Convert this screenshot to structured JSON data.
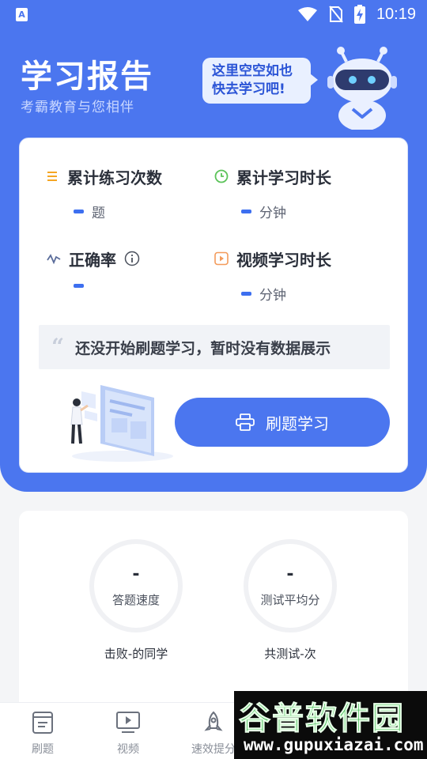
{
  "status_bar": {
    "app_badge": "A",
    "time": "10:19"
  },
  "header": {
    "title": "学习报告",
    "subtitle": "考霸教育与您相伴",
    "bubble_line1": "这里空空如也",
    "bubble_line2": "快去学习吧!"
  },
  "stats": [
    {
      "label": "累计练习次数",
      "value": "",
      "unit": "题",
      "icon": "list-icon",
      "icon_color": "#f5a623"
    },
    {
      "label": "累计学习时长",
      "value": "",
      "unit": "分钟",
      "icon": "clock-icon",
      "icon_color": "#5cc35a"
    },
    {
      "label": "正确率",
      "value": "",
      "unit": "",
      "icon": "pulse-icon",
      "icon_color": "#5a6c9a"
    },
    {
      "label": "视频学习时长",
      "value": "",
      "unit": "分钟",
      "icon": "video-icon",
      "icon_color": "#f39b5b"
    }
  ],
  "empty_note": "还没开始刷题学习，暂时没有数据展示",
  "practice_button": "刷题学习",
  "scores": {
    "speed_value": "-",
    "speed_label": "答题速度",
    "speed_caption": "击败-的同学",
    "avg_value": "-",
    "avg_label": "测试平均分",
    "avg_caption": "共测试-次"
  },
  "tabs": [
    {
      "label": "刷题",
      "icon": "book-icon"
    },
    {
      "label": "视频",
      "icon": "play-screen-icon"
    },
    {
      "label": "速效提分",
      "icon": "rocket-icon"
    }
  ],
  "watermark": {
    "name": "谷普软件园",
    "url": "www.gupuxiazai.com"
  },
  "colors": {
    "primary": "#4b76ef",
    "background": "#f4f5f7",
    "dash": "#3d6ff0"
  }
}
